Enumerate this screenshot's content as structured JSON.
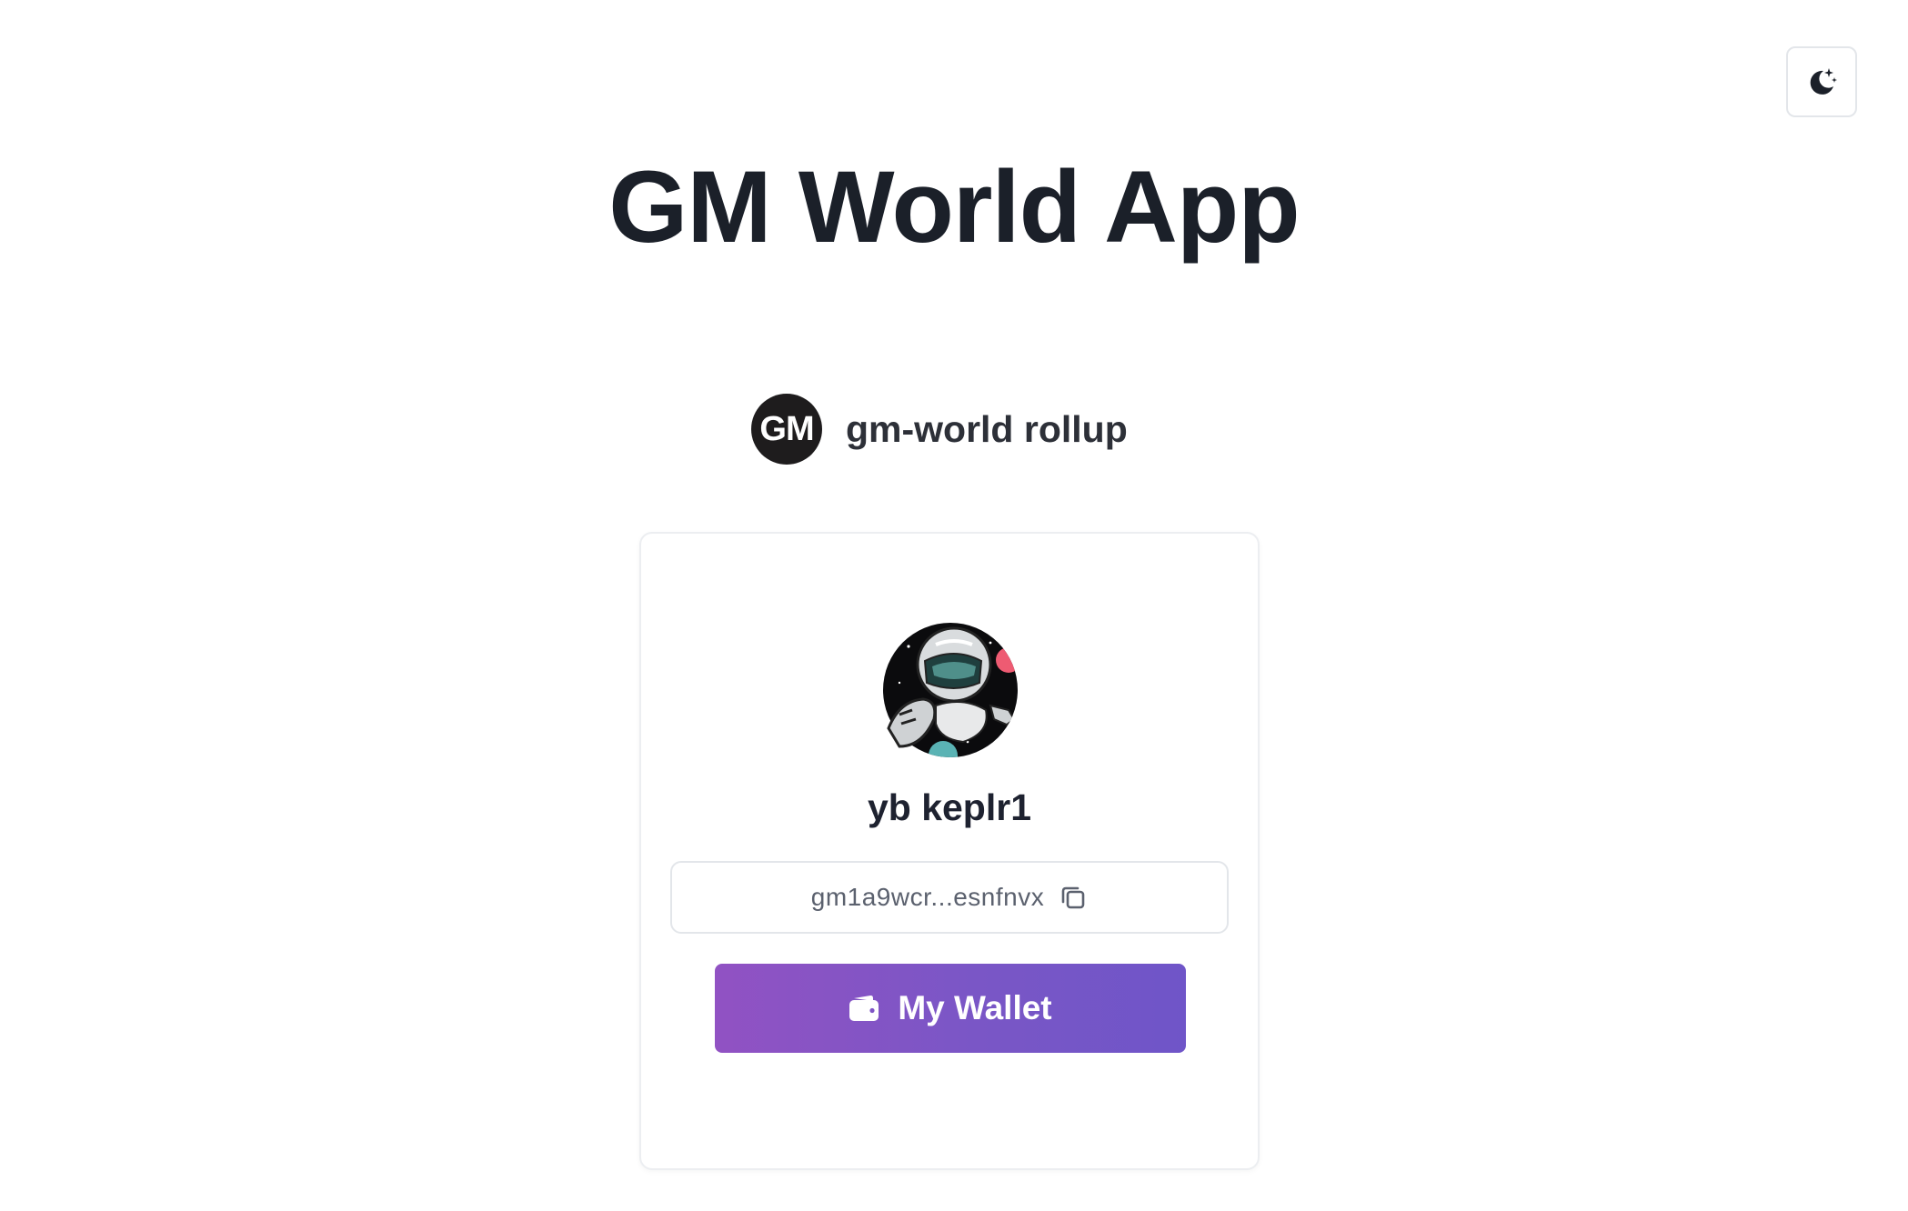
{
  "header": {
    "theme_toggle_icon": "moon-stars-icon"
  },
  "main": {
    "title": "GM World App",
    "chain": {
      "logo_text": "GM",
      "name": "gm-world rollup"
    },
    "wallet_card": {
      "avatar_icon": "astronaut-avatar",
      "username": "yb keplr1",
      "address": "gm1a9wcr...esnfnvx",
      "copy_icon": "copy-icon",
      "wallet_button_label": "My Wallet",
      "wallet_button_icon": "wallet-icon"
    }
  },
  "colors": {
    "title": "#1b2029",
    "button_gradient_start": "#9152c3",
    "button_gradient_end": "#6f55c8",
    "border": "#e3e6ea"
  }
}
